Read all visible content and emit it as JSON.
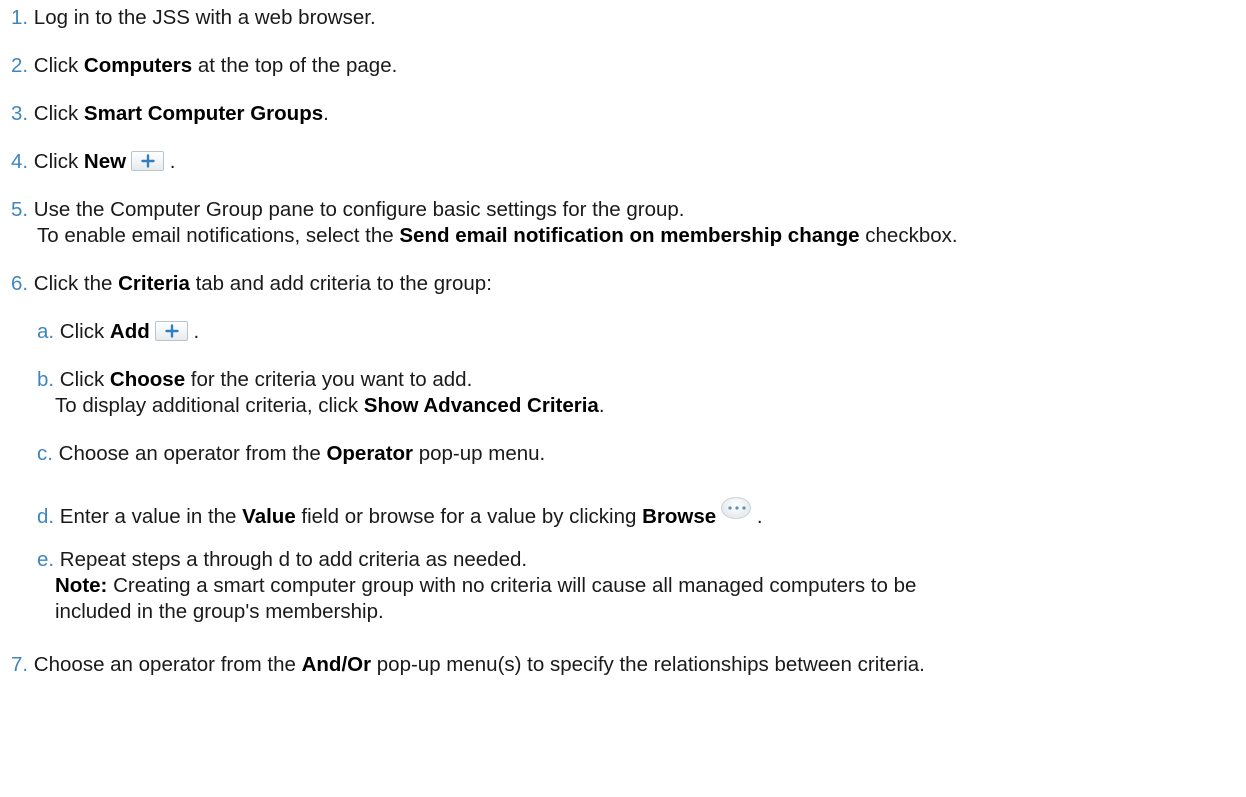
{
  "steps": {
    "s1": {
      "num": "1.",
      "text": " Log in to the JSS with a web browser."
    },
    "s2": {
      "num": "2.",
      "pre": " Click ",
      "bold": "Computers",
      "post": " at the top of the page."
    },
    "s3": {
      "num": "3.",
      "pre": " Click ",
      "bold": "Smart Computer Groups",
      "post": "."
    },
    "s4": {
      "num": "4.",
      "pre": " Click ",
      "bold": "New",
      "post": " .",
      "icon": "plus-icon"
    },
    "s5": {
      "num": "5.",
      "text": " Use the Computer Group pane to configure basic settings for the group.",
      "line2_pre": "To enable email notifications, select the ",
      "line2_bold": "Send email notification on membership change",
      "line2_post": " checkbox."
    },
    "s6": {
      "num": "6.",
      "pre": " Click the ",
      "bold": "Criteria",
      "post": " tab and add criteria to the group:"
    },
    "s6a": {
      "num": "a.",
      "pre": " Click ",
      "bold": "Add",
      "post": " .",
      "icon": "plus-icon"
    },
    "s6b": {
      "num": "b.",
      "pre": " Click ",
      "bold": "Choose",
      "post": " for the criteria you want to add.",
      "line2_pre": "To display additional criteria, click ",
      "line2_bold": "Show Advanced Criteria",
      "line2_post": "."
    },
    "s6c": {
      "num": "c.",
      "pre": " Choose an operator from the ",
      "bold": "Operator",
      "post": " pop-up menu."
    },
    "s6d": {
      "num": "d.",
      "pre": " Enter a value in the ",
      "bold": "Value",
      "mid": " field or browse for a value by clicking ",
      "bold2": "Browse",
      "post": " .",
      "icon": "ellipsis-icon"
    },
    "s6e": {
      "num": "e.",
      "text": " Repeat steps a through d to add criteria as needed.",
      "note_label": "Note:",
      "note_text": " Creating a smart computer group with no criteria will cause all managed computers to be",
      "note_text2": "included in the group's membership."
    },
    "s7": {
      "num": "7.",
      "pre": " Choose an operator from the ",
      "bold": "And/Or",
      "post": " pop-up menu(s) to specify the relationships between criteria."
    }
  },
  "colors": {
    "step_number": "#3f86bf",
    "text": "#1a1a1a"
  }
}
